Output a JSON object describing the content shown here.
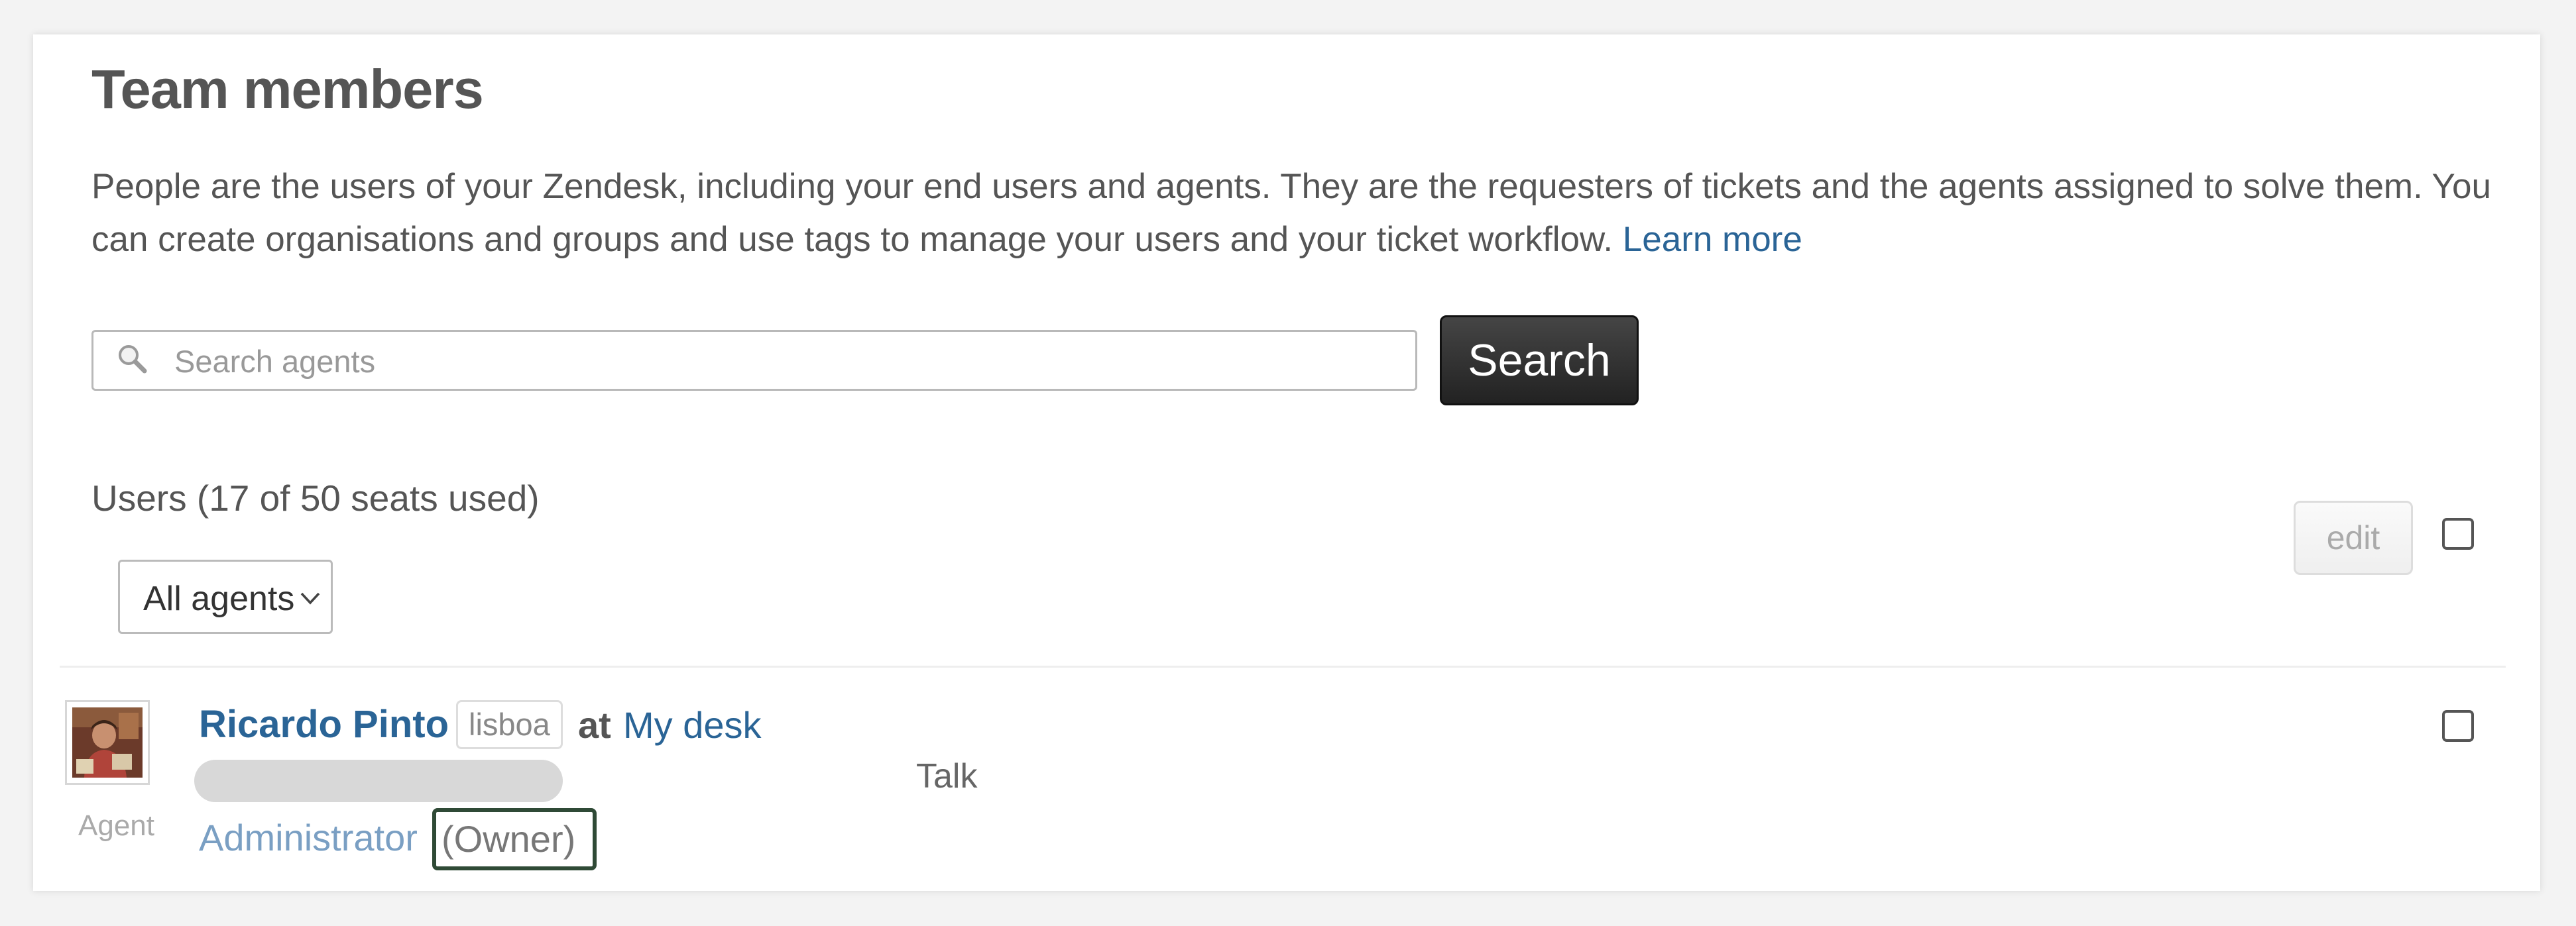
{
  "page": {
    "title": "Team members",
    "description": "People are the users of your Zendesk, including your end users and agents. They are the requesters of tickets and the agents assigned to solve them. You can create organisations and groups and use tags to manage your users and your ticket workflow.",
    "learn_more": "Learn more"
  },
  "search": {
    "placeholder": "Search agents",
    "value": "",
    "button_label": "Search",
    "icon": "search-icon"
  },
  "users": {
    "count_label": "Users (17 of 50 seats used)",
    "filter": {
      "selected": "All agents"
    },
    "edit_label": "edit"
  },
  "user_row": {
    "name": "Ricardo Pinto",
    "location_badge": "lisboa",
    "at_label": "at",
    "desk": "My desk",
    "role_tag": "Agent",
    "channel": "Talk",
    "role": "Administrator",
    "owner_label": "(Owner)"
  },
  "colors": {
    "link": "#2a6496",
    "owner_highlight": "#2f4a36",
    "search_button": "#2a2a2a"
  }
}
